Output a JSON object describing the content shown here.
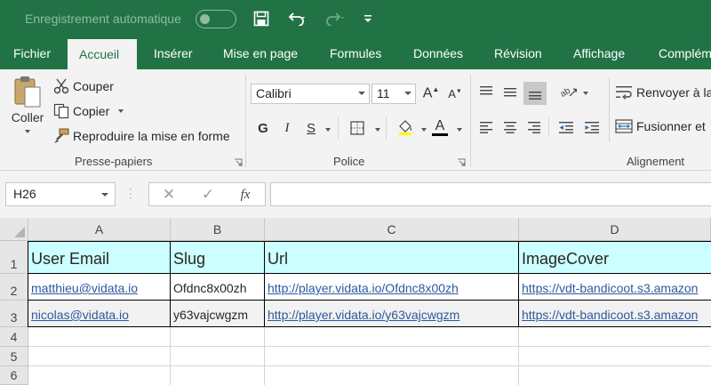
{
  "titlebar": {
    "autosave_label": "Enregistrement automatique",
    "brand_color": "#217346"
  },
  "tabs": [
    {
      "label": "Fichier",
      "active": false
    },
    {
      "label": "Accueil",
      "active": true
    },
    {
      "label": "Insérer",
      "active": false
    },
    {
      "label": "Mise en page",
      "active": false
    },
    {
      "label": "Formules",
      "active": false
    },
    {
      "label": "Données",
      "active": false
    },
    {
      "label": "Révision",
      "active": false
    },
    {
      "label": "Affichage",
      "active": false
    },
    {
      "label": "Complém",
      "active": false
    }
  ],
  "ribbon": {
    "clipboard": {
      "paste_label": "Coller",
      "cut_label": "Couper",
      "copy_label": "Copier",
      "format_painter_label": "Reproduire la mise en forme",
      "group_label": "Presse-papiers"
    },
    "font": {
      "font_name": "Calibri",
      "font_size": "11",
      "bold": "G",
      "italic": "I",
      "underline": "S",
      "font_color_letter": "A",
      "group_label": "Police"
    },
    "alignment": {
      "wrap_label": "Renvoyer à la",
      "merge_label": "Fusionner et",
      "group_label": "Alignement"
    }
  },
  "formula_bar": {
    "name_box": "H26",
    "fx_label": "fx",
    "formula": ""
  },
  "sheet": {
    "columns": [
      "A",
      "B",
      "C",
      "D"
    ],
    "rows": [
      "1",
      "2",
      "3",
      "4",
      "5",
      "6"
    ],
    "header_row": [
      "User Email",
      "Slug",
      "Url",
      "ImageCover"
    ],
    "data_rows": [
      [
        "matthieu@vidata.io",
        "Ofdnc8x00zh",
        "http://player.vidata.io/Ofdnc8x00zh",
        "https://vdt-bandicoot.s3.amazon"
      ],
      [
        "nicolas@vidata.io",
        "y63vajcwgzm",
        "http://player.vidata.io/y63vajcwgzm",
        "https://vdt-bandicoot.s3.amazon"
      ]
    ],
    "header_fill": "#ccffff",
    "link_color": "#2a5aa0"
  }
}
